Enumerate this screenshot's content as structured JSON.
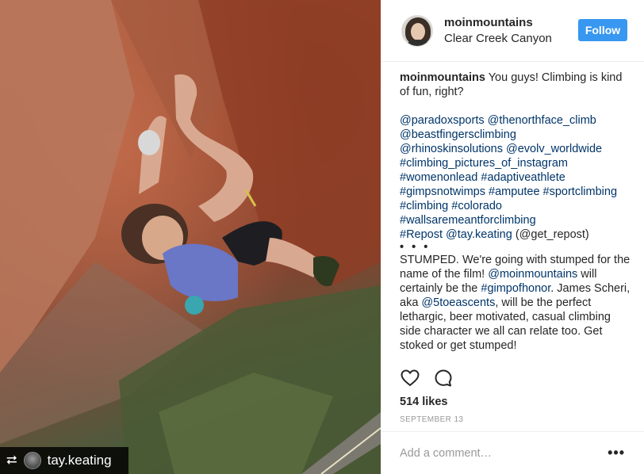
{
  "post": {
    "username": "moinmountains",
    "location": "Clear Creek Canyon",
    "follow_label": "Follow",
    "photo": {
      "repost_icon": "repost-icon",
      "repost_username": "tay.keating"
    },
    "caption": {
      "author": "moinmountains",
      "text": " You guys! Climbing is kind of fun, right?",
      "tags": [
        "@paradoxsports @thenorthface_climb",
        "@beastfingersclimbing",
        "@rhinoskinsolutions @evolv_worldwide",
        "#climbing_pictures_of_instagram",
        "#womenonlead #adaptiveathlete",
        "#gimpsnotwimps #amputee #sportclimbing",
        "#climbing #colorado",
        "#wallsaremeantforclimbing"
      ],
      "repost_prefix": "#Repost @tay.keating",
      "repost_suffix": "(@get_repost)",
      "dots": "• • •",
      "body_1": "STUMPED. We're going with stumped for the name of the film! ",
      "mention_1": "@moinmountains",
      "body_2": " will certainly be the ",
      "mention_2": "#gimpofhonor",
      "body_3": ". James Scheri, aka ",
      "mention_3": "@5toeascents",
      "body_4": ", will be the perfect lethargic, beer motivated, casual climbing side character we all can relate too. Get stoked or get stumped!"
    },
    "likes": "514 likes",
    "date": "SEPTEMBER 13",
    "comment_placeholder": "Add a comment…",
    "more_label": "•••",
    "colors": {
      "accent": "#3897f0",
      "link": "#003569",
      "muted": "#999999"
    }
  }
}
